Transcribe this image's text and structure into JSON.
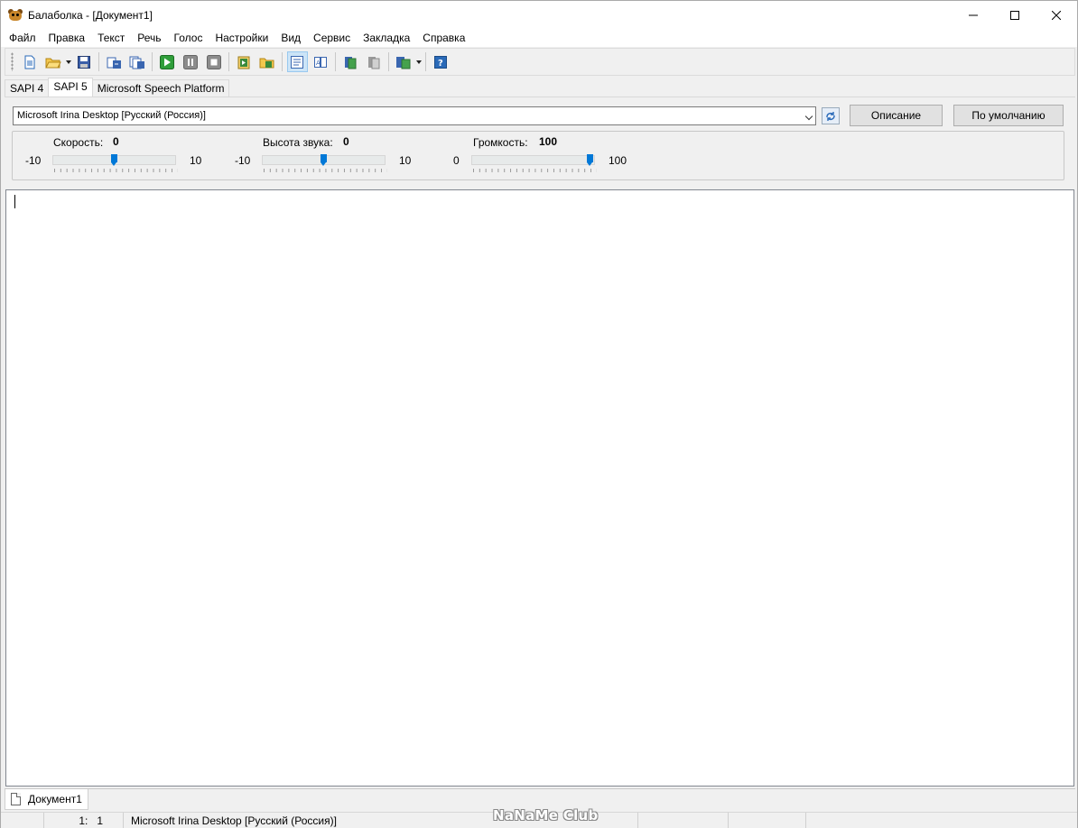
{
  "window": {
    "title": "Балаболка - [Документ1]",
    "icon": "balabolka-app-icon"
  },
  "menu": [
    "Файл",
    "Правка",
    "Текст",
    "Речь",
    "Голос",
    "Настройки",
    "Вид",
    "Сервис",
    "Закладка",
    "Справка"
  ],
  "toolbar": {
    "buttons": [
      "new-document-icon",
      "open-folder-icon",
      "save-icon",
      "export-audio-icon",
      "batch-convert-icon",
      "play-icon",
      "pause-icon",
      "stop-icon",
      "read-clipboard-icon",
      "read-file-icon",
      "show-text-icon",
      "split-text-icon",
      "book-green-icon",
      "book-gray-icon",
      "convert-audio-icon",
      "help-icon"
    ],
    "active_button": "show-text-icon"
  },
  "engine_tabs": {
    "items": [
      "SAPI 4",
      "SAPI 5",
      "Microsoft Speech Platform"
    ],
    "active": "SAPI 5"
  },
  "voice": {
    "selected": "Microsoft Irina Desktop [Русский (Россия)]",
    "description_button": "Описание",
    "default_button": "По умолчанию"
  },
  "sliders": {
    "rate": {
      "label": "Скорость:",
      "value": "0",
      "min": "-10",
      "max": "10",
      "level": 0.5
    },
    "pitch": {
      "label": "Высота звука:",
      "value": "0",
      "min": "-10",
      "max": "10",
      "level": 0.5
    },
    "volume": {
      "label": "Громкость:",
      "value": "100",
      "min": "0",
      "max": "100",
      "level": 1.0
    }
  },
  "editor": {
    "text": ""
  },
  "document_tabs": [
    "Документ1"
  ],
  "status": {
    "position": "1:   1",
    "voice": "Microsoft Irina Desktop [Русский (Россия)]"
  },
  "watermark": "NaNaMe Club"
}
